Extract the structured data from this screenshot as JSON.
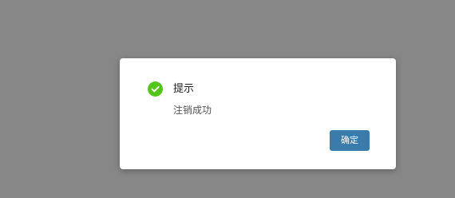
{
  "dialog": {
    "title": "提示",
    "message": "注销成功",
    "ok_label": "确定",
    "icon": "check-circle-icon"
  },
  "colors": {
    "overlay": "#878787",
    "success": "#52c41a",
    "primary_button": "#3a7bab"
  }
}
